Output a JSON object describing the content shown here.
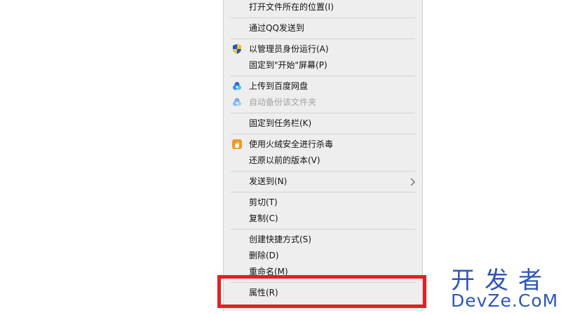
{
  "menu": {
    "items": [
      {
        "label": "打开文件所在的位置(I)",
        "icon": null,
        "disabled": false
      },
      {
        "label": "通过QQ发送到",
        "icon": null,
        "disabled": false
      },
      {
        "label": "以管理员身份运行(A)",
        "icon": "uac-shield-icon",
        "disabled": false
      },
      {
        "label": "固定到\"开始\"屏幕(P)",
        "icon": null,
        "disabled": false
      },
      {
        "label": "上传到百度网盘",
        "icon": "baidu-netdisk-icon",
        "disabled": false
      },
      {
        "label": "自动备份该文件夹",
        "icon": "baidu-netdisk-icon",
        "disabled": true
      },
      {
        "label": "固定到任务栏(K)",
        "icon": null,
        "disabled": false
      },
      {
        "label": "使用火绒安全进行杀毒",
        "icon": "huorong-icon",
        "disabled": false
      },
      {
        "label": "还原以前的版本(V)",
        "icon": null,
        "disabled": false
      },
      {
        "label": "发送到(N)",
        "icon": null,
        "disabled": false,
        "submenu": true
      },
      {
        "label": "剪切(T)",
        "icon": null,
        "disabled": false
      },
      {
        "label": "复制(C)",
        "icon": null,
        "disabled": false
      },
      {
        "label": "创建快捷方式(S)",
        "icon": null,
        "disabled": false
      },
      {
        "label": "删除(D)",
        "icon": null,
        "disabled": false
      },
      {
        "label": "重命名(M)",
        "icon": null,
        "disabled": false
      },
      {
        "label": "属性(R)",
        "icon": null,
        "disabled": false
      }
    ]
  },
  "highlight": {
    "color": "#e21f26"
  },
  "watermark": {
    "cn": "开发者",
    "en": "DevZe.CoM",
    "color": "#2f56b8"
  }
}
